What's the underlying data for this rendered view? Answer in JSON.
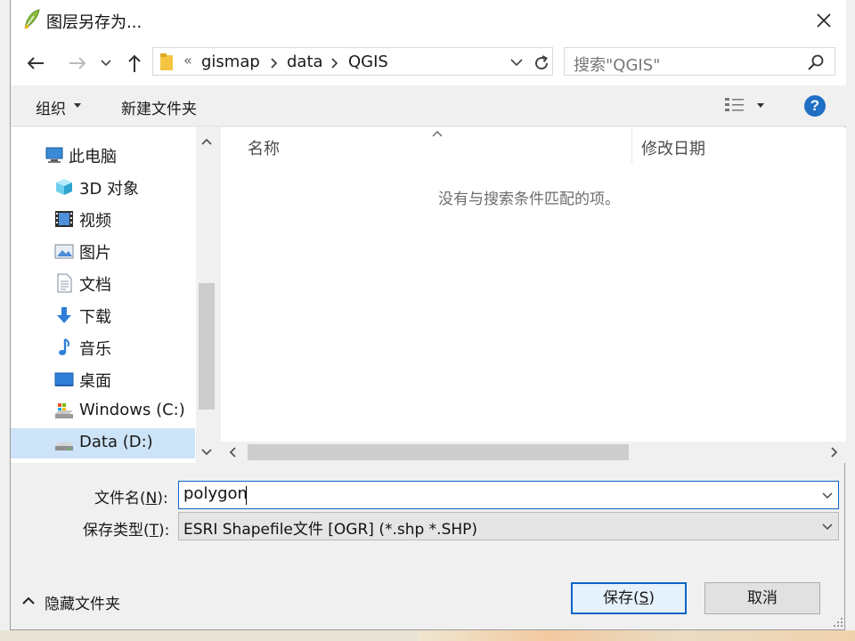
{
  "window": {
    "title": "图层另存为..."
  },
  "nav": {
    "crumb_lead": "«",
    "breadcrumb": [
      "gismap",
      "data",
      "QGIS"
    ],
    "search_placeholder": "搜索\"QGIS\""
  },
  "toolbar": {
    "organize": "组织",
    "new_folder": "新建文件夹",
    "help": "?"
  },
  "sidebar": {
    "items": [
      {
        "label": "此电脑",
        "icon": "computer-icon"
      },
      {
        "label": "3D 对象",
        "icon": "cube-icon"
      },
      {
        "label": "视频",
        "icon": "video-icon"
      },
      {
        "label": "图片",
        "icon": "picture-icon"
      },
      {
        "label": "文档",
        "icon": "document-icon"
      },
      {
        "label": "下载",
        "icon": "download-arrow-icon"
      },
      {
        "label": "音乐",
        "icon": "music-note-icon"
      },
      {
        "label": "桌面",
        "icon": "desktop-icon"
      },
      {
        "label": "Windows (C:)",
        "icon": "system-drive-icon"
      },
      {
        "label": "Data (D:)",
        "icon": "drive-icon"
      }
    ],
    "selected_index": 9
  },
  "files": {
    "columns": [
      "名称",
      "修改日期"
    ],
    "empty_message": "没有与搜索条件匹配的项。"
  },
  "form": {
    "filename_label_pre": "文件名(",
    "filename_label_key": "N",
    "filename_label_post": "):",
    "filename_value": "polygon",
    "filetype_label_pre": "保存类型(",
    "filetype_label_key": "T",
    "filetype_label_post": "):",
    "filetype_value": "ESRI Shapefile文件 [OGR] (*.shp *.SHP)"
  },
  "footer": {
    "hide_folders": "隐藏文件夹",
    "save_pre": "保存(",
    "save_key": "S",
    "save_post": ")",
    "cancel": "取消"
  },
  "colors": {
    "accent": "#0a64c8",
    "selection": "#cde3f7",
    "help": "#1f6fc4"
  }
}
